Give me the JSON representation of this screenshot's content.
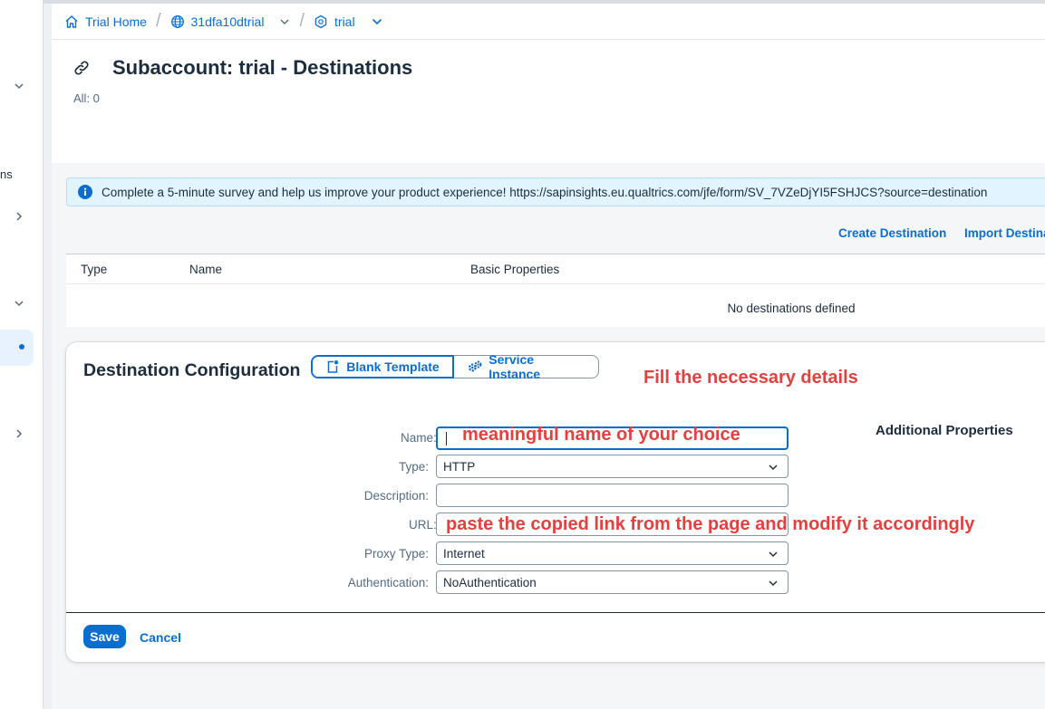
{
  "breadcrumb": {
    "home": "Trial Home",
    "global_account": "31dfa10dtrial",
    "subaccount": "trial"
  },
  "sidebar": {
    "partial_text": "ns"
  },
  "page": {
    "title": "Subaccount: trial - Destinations",
    "count": "All: 0"
  },
  "info_banner": {
    "text": "Complete a 5-minute survey and help us improve your product experience! https://sapinsights.eu.qualtrics.com/jfe/form/SV_7VZeDjYI5FSHJCS?source=destination"
  },
  "toolbar": {
    "create": "Create Destination",
    "import": "Import Destinations"
  },
  "table": {
    "columns": [
      "Type",
      "Name",
      "Basic Properties"
    ],
    "empty_text": "No destinations defined"
  },
  "config": {
    "title": "Destination Configuration",
    "blank_template": "Blank Template",
    "service_instance": "Service Instance",
    "additional_properties": "Additional Properties",
    "fields": {
      "name": {
        "label": "Name:",
        "value": ""
      },
      "type": {
        "label": "Type:",
        "value": "HTTP"
      },
      "description": {
        "label": "Description:",
        "value": ""
      },
      "url": {
        "label": "URL:",
        "value": ""
      },
      "proxy_type": {
        "label": "Proxy Type:",
        "value": "Internet"
      },
      "authentication": {
        "label": "Authentication:",
        "value": "NoAuthentication"
      }
    },
    "save": "Save",
    "cancel": "Cancel"
  },
  "annotations": {
    "fill_details": "Fill the necessary details",
    "name_hint": "meaningful name of your choice",
    "url_hint": "paste the copied link from the page and modify it accordingly"
  },
  "colors": {
    "brand_blue": "#0a6ed1",
    "annotation_red": "#e3413f",
    "info_bg": "#e1f4ff"
  }
}
